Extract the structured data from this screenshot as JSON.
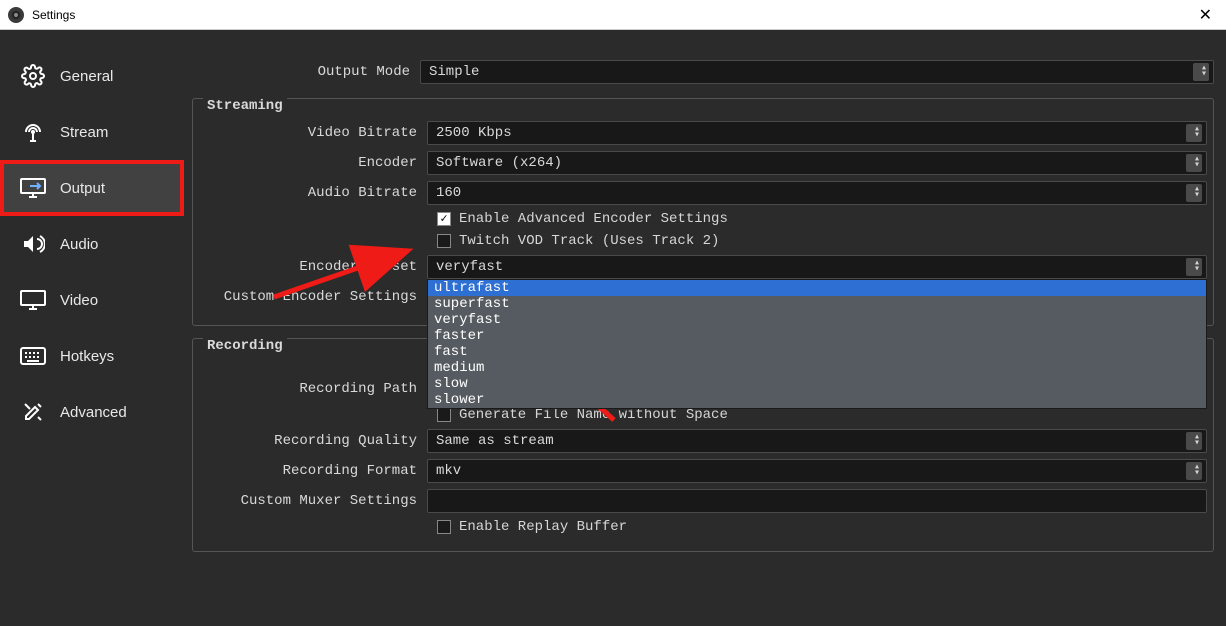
{
  "window": {
    "title": "Settings"
  },
  "sidebar": {
    "items": [
      {
        "label": "General"
      },
      {
        "label": "Stream"
      },
      {
        "label": "Output"
      },
      {
        "label": "Audio"
      },
      {
        "label": "Video"
      },
      {
        "label": "Hotkeys"
      },
      {
        "label": "Advanced"
      }
    ]
  },
  "output": {
    "mode_label": "Output Mode",
    "mode_value": "Simple"
  },
  "streaming": {
    "legend": "Streaming",
    "video_bitrate_label": "Video Bitrate",
    "video_bitrate_value": "2500 Kbps",
    "encoder_label": "Encoder",
    "encoder_value": "Software (x264)",
    "audio_bitrate_label": "Audio Bitrate",
    "audio_bitrate_value": "160",
    "enable_advanced_label": "Enable Advanced Encoder Settings",
    "twitch_vod_label": "Twitch VOD Track (Uses Track 2)",
    "encoder_preset_label": "Encoder Preset",
    "encoder_preset_value": "veryfast",
    "custom_encoder_label": "Custom Encoder Settings",
    "preset_options": [
      "ultrafast",
      "superfast",
      "veryfast",
      "faster",
      "fast",
      "medium",
      "slow",
      "slower"
    ]
  },
  "recording": {
    "legend": "Recording",
    "path_label": "Recording Path",
    "path_value": "",
    "filename_nospace_label": "Generate File Name without Space",
    "quality_label": "Recording Quality",
    "quality_value": "Same as stream",
    "format_label": "Recording Format",
    "format_value": "mkv",
    "muxer_label": "Custom Muxer Settings",
    "muxer_value": "",
    "replay_buffer_label": "Enable Replay Buffer"
  }
}
